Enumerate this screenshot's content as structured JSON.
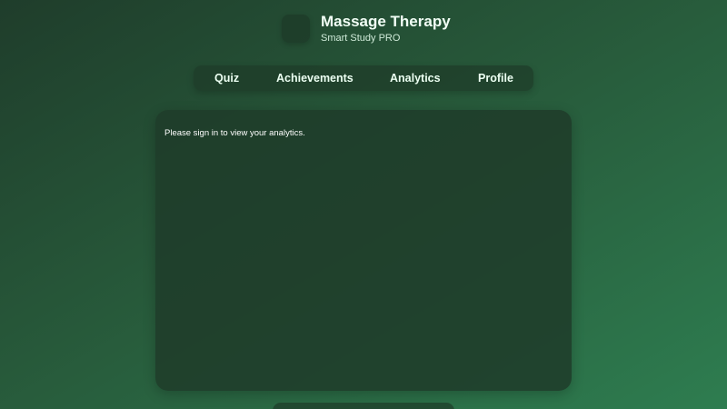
{
  "header": {
    "title": "Massage Therapy",
    "subtitle": "Smart Study PRO",
    "logo_icon": "app-logo-icon"
  },
  "nav": {
    "items": [
      {
        "label": "Quiz"
      },
      {
        "label": "Achievements"
      },
      {
        "label": "Analytics"
      },
      {
        "label": "Profile"
      }
    ]
  },
  "main": {
    "message": "Please sign in to view your analytics."
  },
  "colors": {
    "background_start": "#1f3d2b",
    "background_end": "#2e7d50",
    "panel": "#1f3c2a",
    "text": "#ffffff"
  }
}
